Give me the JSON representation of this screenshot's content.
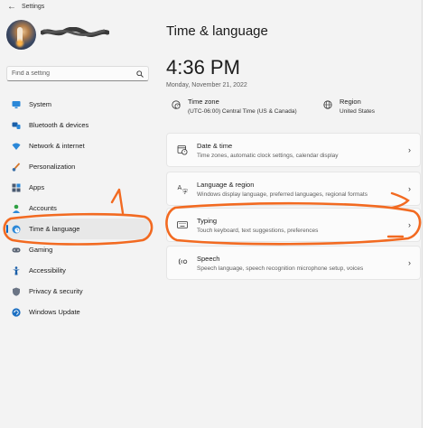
{
  "window": {
    "title": "Settings",
    "back_icon": "back-arrow-icon"
  },
  "profile": {
    "avatar_icon": "rocket-avatar",
    "name_redacted": true
  },
  "search": {
    "placeholder": "Find a setting",
    "icon": "search-icon"
  },
  "sidebar": {
    "items": [
      {
        "label": "System",
        "icon": "monitor-icon",
        "active": false
      },
      {
        "label": "Bluetooth & devices",
        "icon": "bluetooth-icon",
        "active": false
      },
      {
        "label": "Network & internet",
        "icon": "wifi-icon",
        "active": false
      },
      {
        "label": "Personalization",
        "icon": "brush-icon",
        "active": false
      },
      {
        "label": "Apps",
        "icon": "apps-icon",
        "active": false
      },
      {
        "label": "Accounts",
        "icon": "person-icon",
        "active": false
      },
      {
        "label": "Time & language",
        "icon": "globe-clock-icon",
        "active": true
      },
      {
        "label": "Gaming",
        "icon": "controller-icon",
        "active": false
      },
      {
        "label": "Accessibility",
        "icon": "accessibility-icon",
        "active": false
      },
      {
        "label": "Privacy & security",
        "icon": "shield-icon",
        "active": false
      },
      {
        "label": "Windows Update",
        "icon": "update-icon",
        "active": false
      }
    ]
  },
  "main": {
    "title": "Time & language",
    "time": "4:36 PM",
    "date": "Monday, November 21, 2022",
    "time_zone": {
      "label": "Time zone",
      "value": "(UTC-06:00) Central Time (US & Canada)",
      "icon": "globe-clock-icon"
    },
    "region": {
      "label": "Region",
      "value": "United States",
      "icon": "globe-icon"
    },
    "cards": [
      {
        "title": "Date & time",
        "subtitle": "Time zones, automatic clock settings, calendar display",
        "icon": "calendar-clock-icon"
      },
      {
        "title": "Language & region",
        "subtitle": "Windows display language, preferred languages, regional formats",
        "icon": "language-icon"
      },
      {
        "title": "Typing",
        "subtitle": "Touch keyboard, text suggestions, preferences",
        "icon": "keyboard-icon"
      },
      {
        "title": "Speech",
        "subtitle": "Speech language, speech recognition microphone setup, voices",
        "icon": "microphone-icon"
      }
    ]
  },
  "annotations": {
    "color": "#f26a21",
    "number": "1"
  },
  "colors": {
    "accent": "#0067c0",
    "background": "#f3f3f3",
    "card": "#fbfbfb"
  }
}
